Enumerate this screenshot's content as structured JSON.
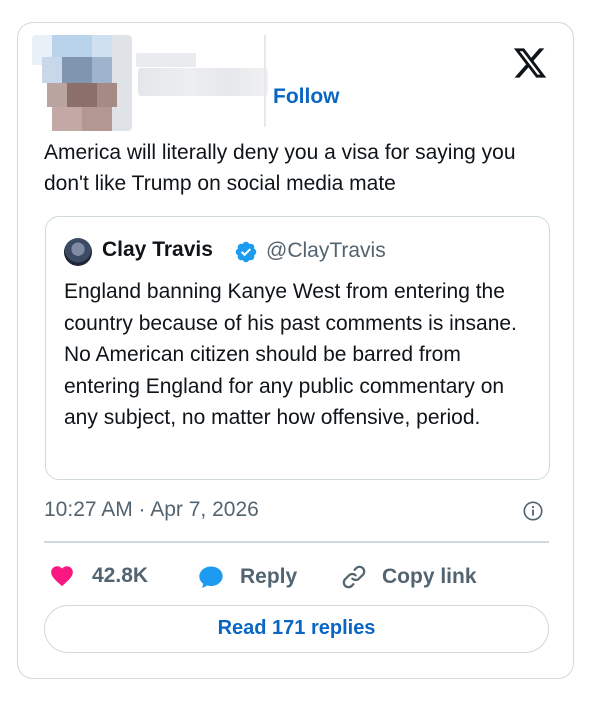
{
  "header": {
    "follow_label": "Follow",
    "brand_icon": "x-logo-icon"
  },
  "tweet": {
    "text": "America will literally deny you a visa for saying you don't like Trump on social media mate",
    "timestamp": "10:27 AM · Apr 7, 2026"
  },
  "quoted": {
    "name": "Clay Travis",
    "handle": "@ClayTravis",
    "verified_icon": "verified-badge-icon",
    "text": "England banning Kanye West from entering the country because of his past comments is insane. No American citizen should be barred from entering England for any public commentary on any subject, no matter how offensive, period."
  },
  "actions": {
    "likes": "42.8K",
    "reply_label": "Reply",
    "copy_label": "Copy link"
  },
  "read_replies_label": "Read 171 replies",
  "colors": {
    "accent": "#0a66c2",
    "like": "#f91880",
    "reply_icon": "#1d9bf0",
    "verified": "#1d9bf0",
    "secondary_text": "#536471",
    "border": "#cfd9de"
  }
}
